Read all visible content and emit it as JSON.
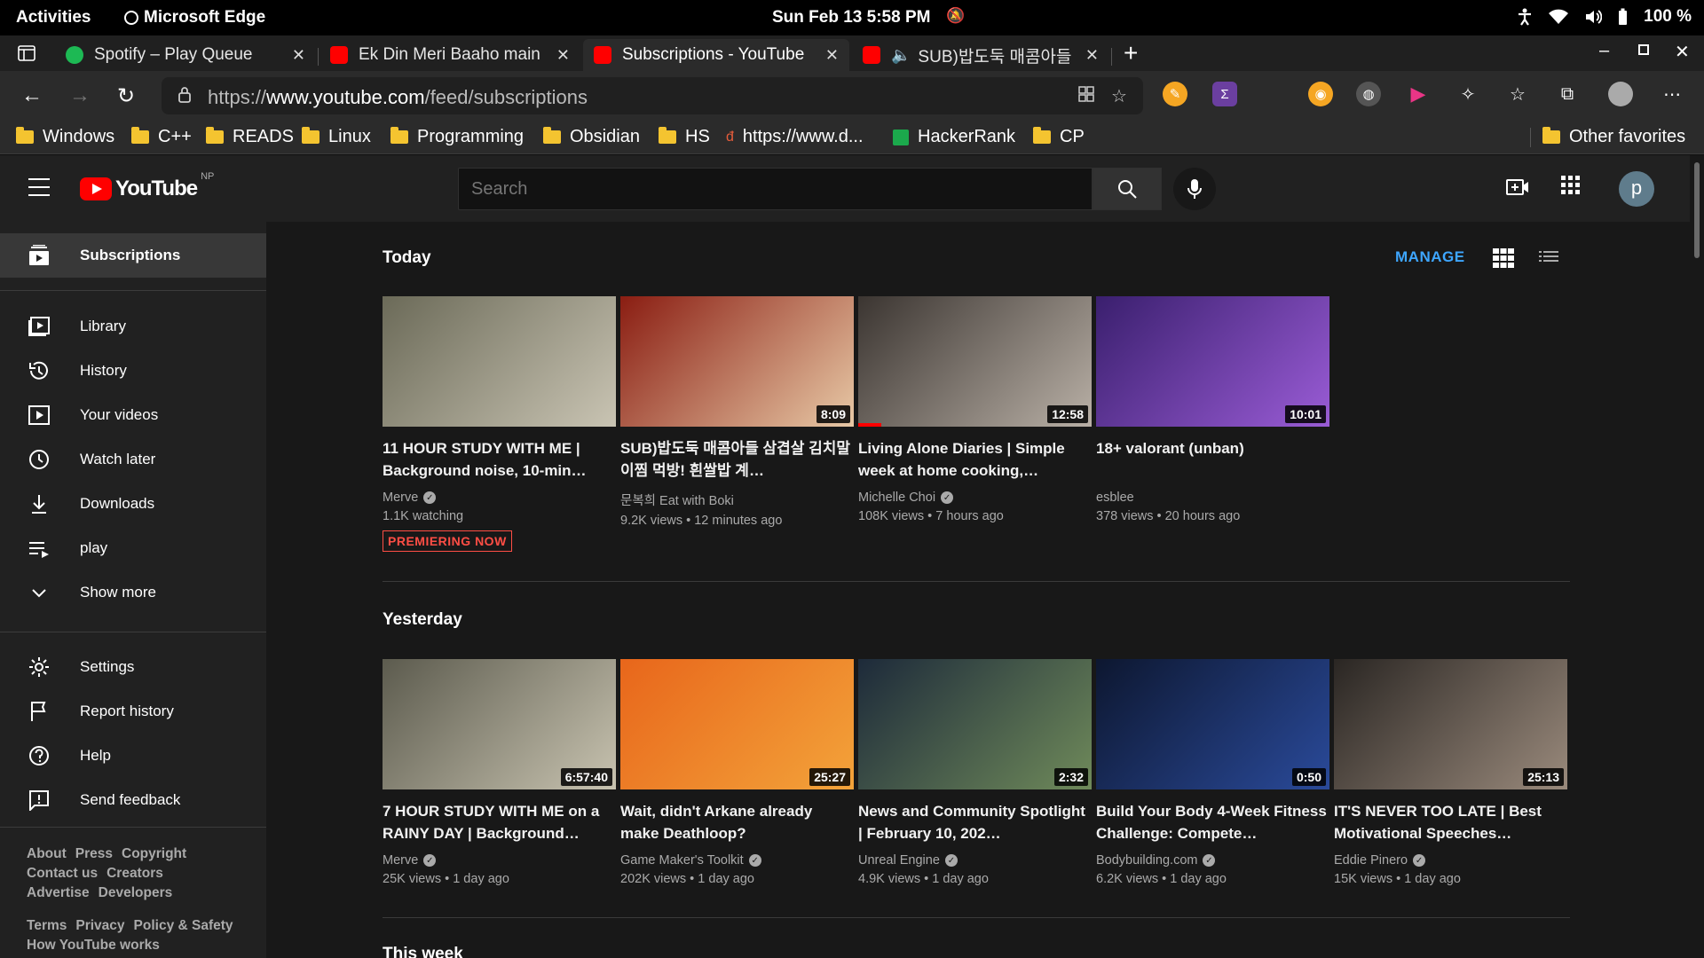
{
  "system": {
    "activities": "Activities",
    "app_name": "Microsoft Edge",
    "clock": "Sun Feb 13  5:58 PM",
    "battery": "100 %"
  },
  "tabs": [
    {
      "title": "Spotify – Play Queue",
      "fav_color": "#1db954"
    },
    {
      "title": "Ek Din Meri Baaho main",
      "fav_color": "#ff0000"
    },
    {
      "title": "Subscriptions - YouTube",
      "fav_color": "#ff0000"
    },
    {
      "title": "SUB)밥도둑 매콤아들",
      "fav_color": "#ff0000"
    }
  ],
  "address": {
    "prefix": "https://",
    "host": "www.youtube.com",
    "path": "/feed/subscriptions"
  },
  "bookmarks": [
    "Windows",
    "C++",
    "READS",
    "Linux",
    "Programming",
    "Obsidian",
    "HS",
    "https://www.d...",
    "HackerRank",
    "CP"
  ],
  "other_favorites": "Other favorites",
  "youtube": {
    "logo_text": "YouTube",
    "region": "NP",
    "search_placeholder": "Search",
    "avatar_letter": "p"
  },
  "sidebar": {
    "items": [
      {
        "label": "Subscriptions",
        "icon": "subscriptions-icon"
      },
      {
        "label": "Library",
        "icon": "library-icon"
      },
      {
        "label": "History",
        "icon": "history-icon"
      },
      {
        "label": "Your videos",
        "icon": "your-videos-icon"
      },
      {
        "label": "Watch later",
        "icon": "watch-later-icon"
      },
      {
        "label": "Downloads",
        "icon": "downloads-icon"
      },
      {
        "label": "play",
        "icon": "playlist-icon"
      },
      {
        "label": "Show more",
        "icon": "chevron-down-icon"
      },
      {
        "label": "Settings",
        "icon": "gear-icon"
      },
      {
        "label": "Report history",
        "icon": "flag-icon"
      },
      {
        "label": "Help",
        "icon": "help-icon"
      },
      {
        "label": "Send feedback",
        "icon": "feedback-icon"
      }
    ],
    "footer": [
      [
        "About",
        "Press",
        "Copyright"
      ],
      [
        "Contact us",
        "Creators"
      ],
      [
        "Advertise",
        "Developers"
      ],
      [
        "Terms",
        "Privacy",
        "Policy & Safety"
      ],
      [
        "How YouTube works"
      ]
    ]
  },
  "main": {
    "manage": "MANAGE",
    "sections": [
      {
        "heading": "Today",
        "videos": [
          {
            "title": "11 HOUR STUDY WITH ME | Background noise, 10-min…",
            "channel": "Merve",
            "verified": true,
            "meta": "1.1K watching",
            "badge": "PREMIERING NOW",
            "duration": "",
            "thumb": [
              "#6b6a58",
              "#c9c4b3"
            ]
          },
          {
            "title": "SUB)밥도둑 매콤아들 삼겹살 김치말이찜 먹방! 흰쌀밥 계…",
            "channel": "문복희 Eat with Boki",
            "verified": false,
            "meta": "9.2K views • 12 minutes ago",
            "badge": "",
            "duration": "8:09",
            "thumb": [
              "#8a1d12",
              "#e8c9a6"
            ]
          },
          {
            "title": "Living Alone Diaries | Simple week at home cooking,…",
            "channel": "Michelle Choi",
            "verified": true,
            "meta": "108K views • 7 hours ago",
            "badge": "",
            "duration": "12:58",
            "progress": 0.1,
            "thumb": [
              "#3b3531",
              "#b9b0a6"
            ]
          },
          {
            "title": "18+ valorant (unban)",
            "channel": "esblee",
            "verified": false,
            "meta": "378 views • 20 hours ago",
            "badge": "",
            "duration": "10:01",
            "thumb": [
              "#3a1f6e",
              "#9a5cd6"
            ]
          }
        ]
      },
      {
        "heading": "Yesterday",
        "videos": [
          {
            "title": "7 HOUR STUDY WITH ME on a RAINY DAY | Background…",
            "channel": "Merve",
            "verified": true,
            "meta": "25K views • 1 day ago",
            "badge": "",
            "duration": "6:57:40",
            "thumb": [
              "#5c5b4e",
              "#c8c3b0"
            ]
          },
          {
            "title": "Wait, didn't Arkane already make Deathloop?",
            "channel": "Game Maker's Toolkit",
            "verified": true,
            "meta": "202K views • 1 day ago",
            "badge": "",
            "duration": "25:27",
            "thumb": [
              "#e8661b",
              "#f3a33a"
            ]
          },
          {
            "title": "News and Community Spotlight | February 10, 202…",
            "channel": "Unreal Engine",
            "verified": true,
            "meta": "4.9K views • 1 day ago",
            "badge": "",
            "duration": "2:32",
            "thumb": [
              "#1d2a3a",
              "#6f8a5a"
            ]
          },
          {
            "title": "Build Your Body 4-Week Fitness Challenge: Compete…",
            "channel": "Bodybuilding.com",
            "verified": true,
            "meta": "6.2K views • 1 day ago",
            "badge": "",
            "duration": "0:50",
            "thumb": [
              "#0d1730",
              "#2a4a9a"
            ]
          },
          {
            "title": "IT'S NEVER TOO LATE | Best Motivational Speeches…",
            "channel": "Eddie Pinero",
            "verified": true,
            "meta": "15K views • 1 day ago",
            "badge": "",
            "duration": "25:13",
            "thumb": [
              "#2a2623",
              "#9a8a7c"
            ]
          }
        ]
      },
      {
        "heading": "This week",
        "videos": []
      }
    ]
  }
}
